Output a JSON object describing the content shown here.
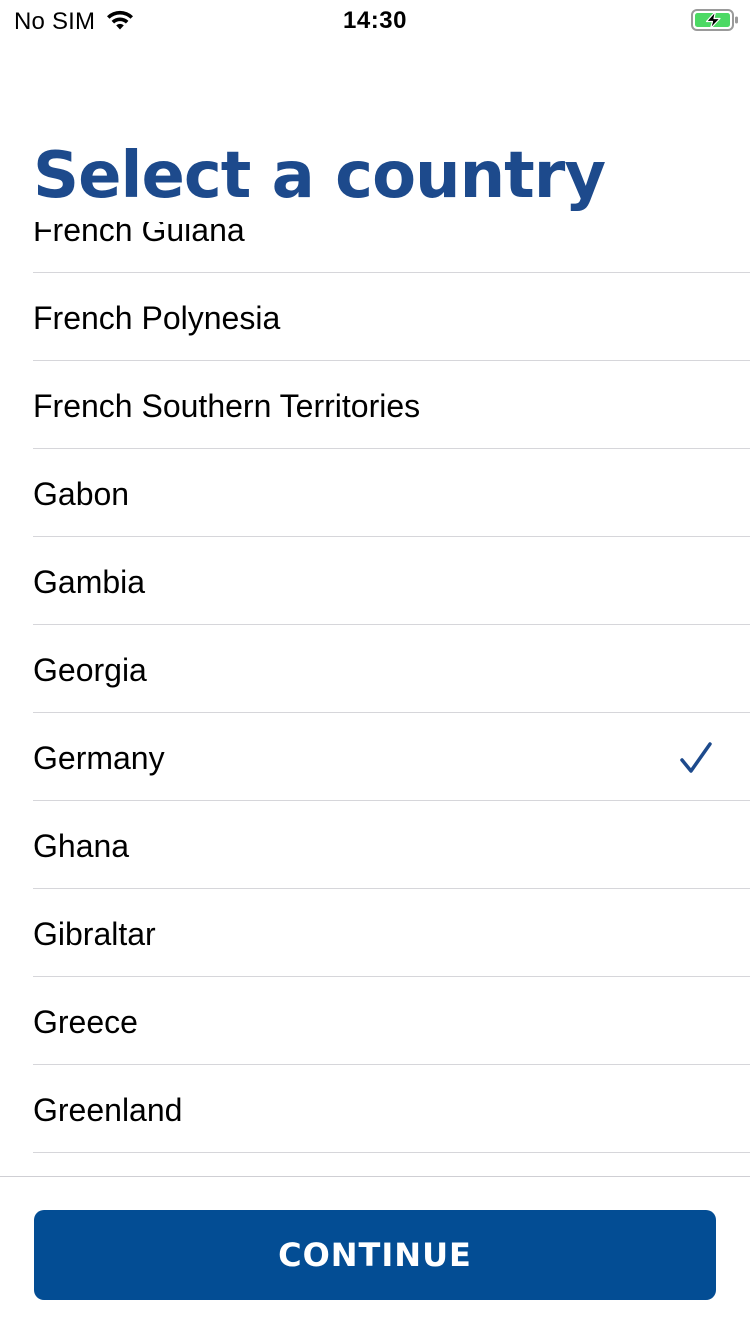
{
  "status_bar": {
    "carrier": "No SIM",
    "time": "14:30",
    "wifi_icon": "wifi-icon",
    "battery_icon": "battery-charging-icon",
    "battery_color": "#4cd964"
  },
  "header": {
    "title": "Select a country"
  },
  "countries": {
    "items": [
      {
        "label": "French Guiana",
        "selected": false
      },
      {
        "label": "French Polynesia",
        "selected": false
      },
      {
        "label": "French Southern Territories",
        "selected": false
      },
      {
        "label": "Gabon",
        "selected": false
      },
      {
        "label": "Gambia",
        "selected": false
      },
      {
        "label": "Georgia",
        "selected": false
      },
      {
        "label": "Germany",
        "selected": true
      },
      {
        "label": "Ghana",
        "selected": false
      },
      {
        "label": "Gibraltar",
        "selected": false
      },
      {
        "label": "Greece",
        "selected": false
      },
      {
        "label": "Greenland",
        "selected": false
      }
    ],
    "selected_icon": "checkmark-icon"
  },
  "footer": {
    "continue_label": "CONTINUE"
  },
  "colors": {
    "brand_blue": "#1d4a8c",
    "button_blue": "#034d94",
    "separator": "#d6d6da"
  }
}
